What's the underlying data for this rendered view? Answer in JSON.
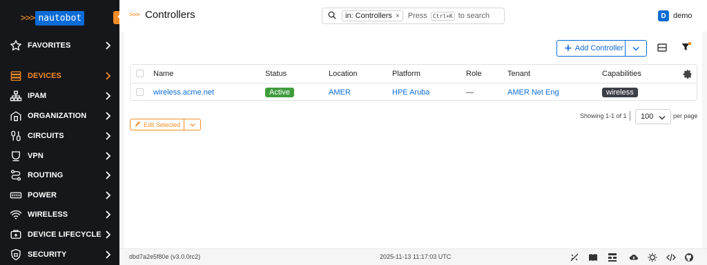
{
  "brand": {
    "chevrons": ">>>",
    "name": "nautobot"
  },
  "sidebar": {
    "items": [
      {
        "label": "FAVORITES",
        "icon": "star-icon",
        "active": false
      },
      {
        "label": "DEVICES",
        "icon": "devices-icon",
        "active": true
      },
      {
        "label": "IPAM",
        "icon": "ipam-icon",
        "active": false
      },
      {
        "label": "ORGANIZATION",
        "icon": "organization-icon",
        "active": false
      },
      {
        "label": "CIRCUITS",
        "icon": "circuits-icon",
        "active": false
      },
      {
        "label": "VPN",
        "icon": "vpn-icon",
        "active": false
      },
      {
        "label": "ROUTING",
        "icon": "routing-icon",
        "active": false
      },
      {
        "label": "POWER",
        "icon": "power-icon",
        "active": false
      },
      {
        "label": "WIRELESS",
        "icon": "wireless-icon",
        "active": false
      },
      {
        "label": "DEVICE LIFECYCLE",
        "icon": "lifecycle-icon",
        "active": false
      },
      {
        "label": "SECURITY",
        "icon": "security-icon",
        "active": false
      }
    ]
  },
  "header": {
    "title_chevrons": ">>>",
    "title": "Controllers",
    "search": {
      "chip": "in: Controllers",
      "chip_close": "×",
      "press": "Press",
      "shortcut": "Ctrl+K",
      "to_search": "to search"
    },
    "user": {
      "initial": "D",
      "name": "demo"
    }
  },
  "toolbar": {
    "add_label": "Add Controller"
  },
  "table": {
    "columns": [
      "Name",
      "Status",
      "Location",
      "Platform",
      "Role",
      "Tenant",
      "Capabilities"
    ],
    "rows": [
      {
        "name": "wireless.acme.net",
        "status": "Active",
        "location": "AMER",
        "platform": "HPE Aruba",
        "role": "—",
        "tenant": "AMER Net Eng",
        "capabilities": "wireless"
      }
    ]
  },
  "bulk": {
    "edit_label": "Edit Selected"
  },
  "pagination": {
    "showing": "Showing 1-1 of 1",
    "per_page_value": "100",
    "per_page_label": "per page"
  },
  "footer": {
    "version": "dbd7a2e5f80e (v3.0.0rc2)",
    "timestamp": "2025-11-13 11:17:03 UTC"
  },
  "colors": {
    "accent": "#f28c28",
    "primary": "#0b6cd6",
    "sidebar_bg": "#16171a",
    "status_active": "#3f9c3c",
    "badge_dark": "#3b3f46"
  }
}
